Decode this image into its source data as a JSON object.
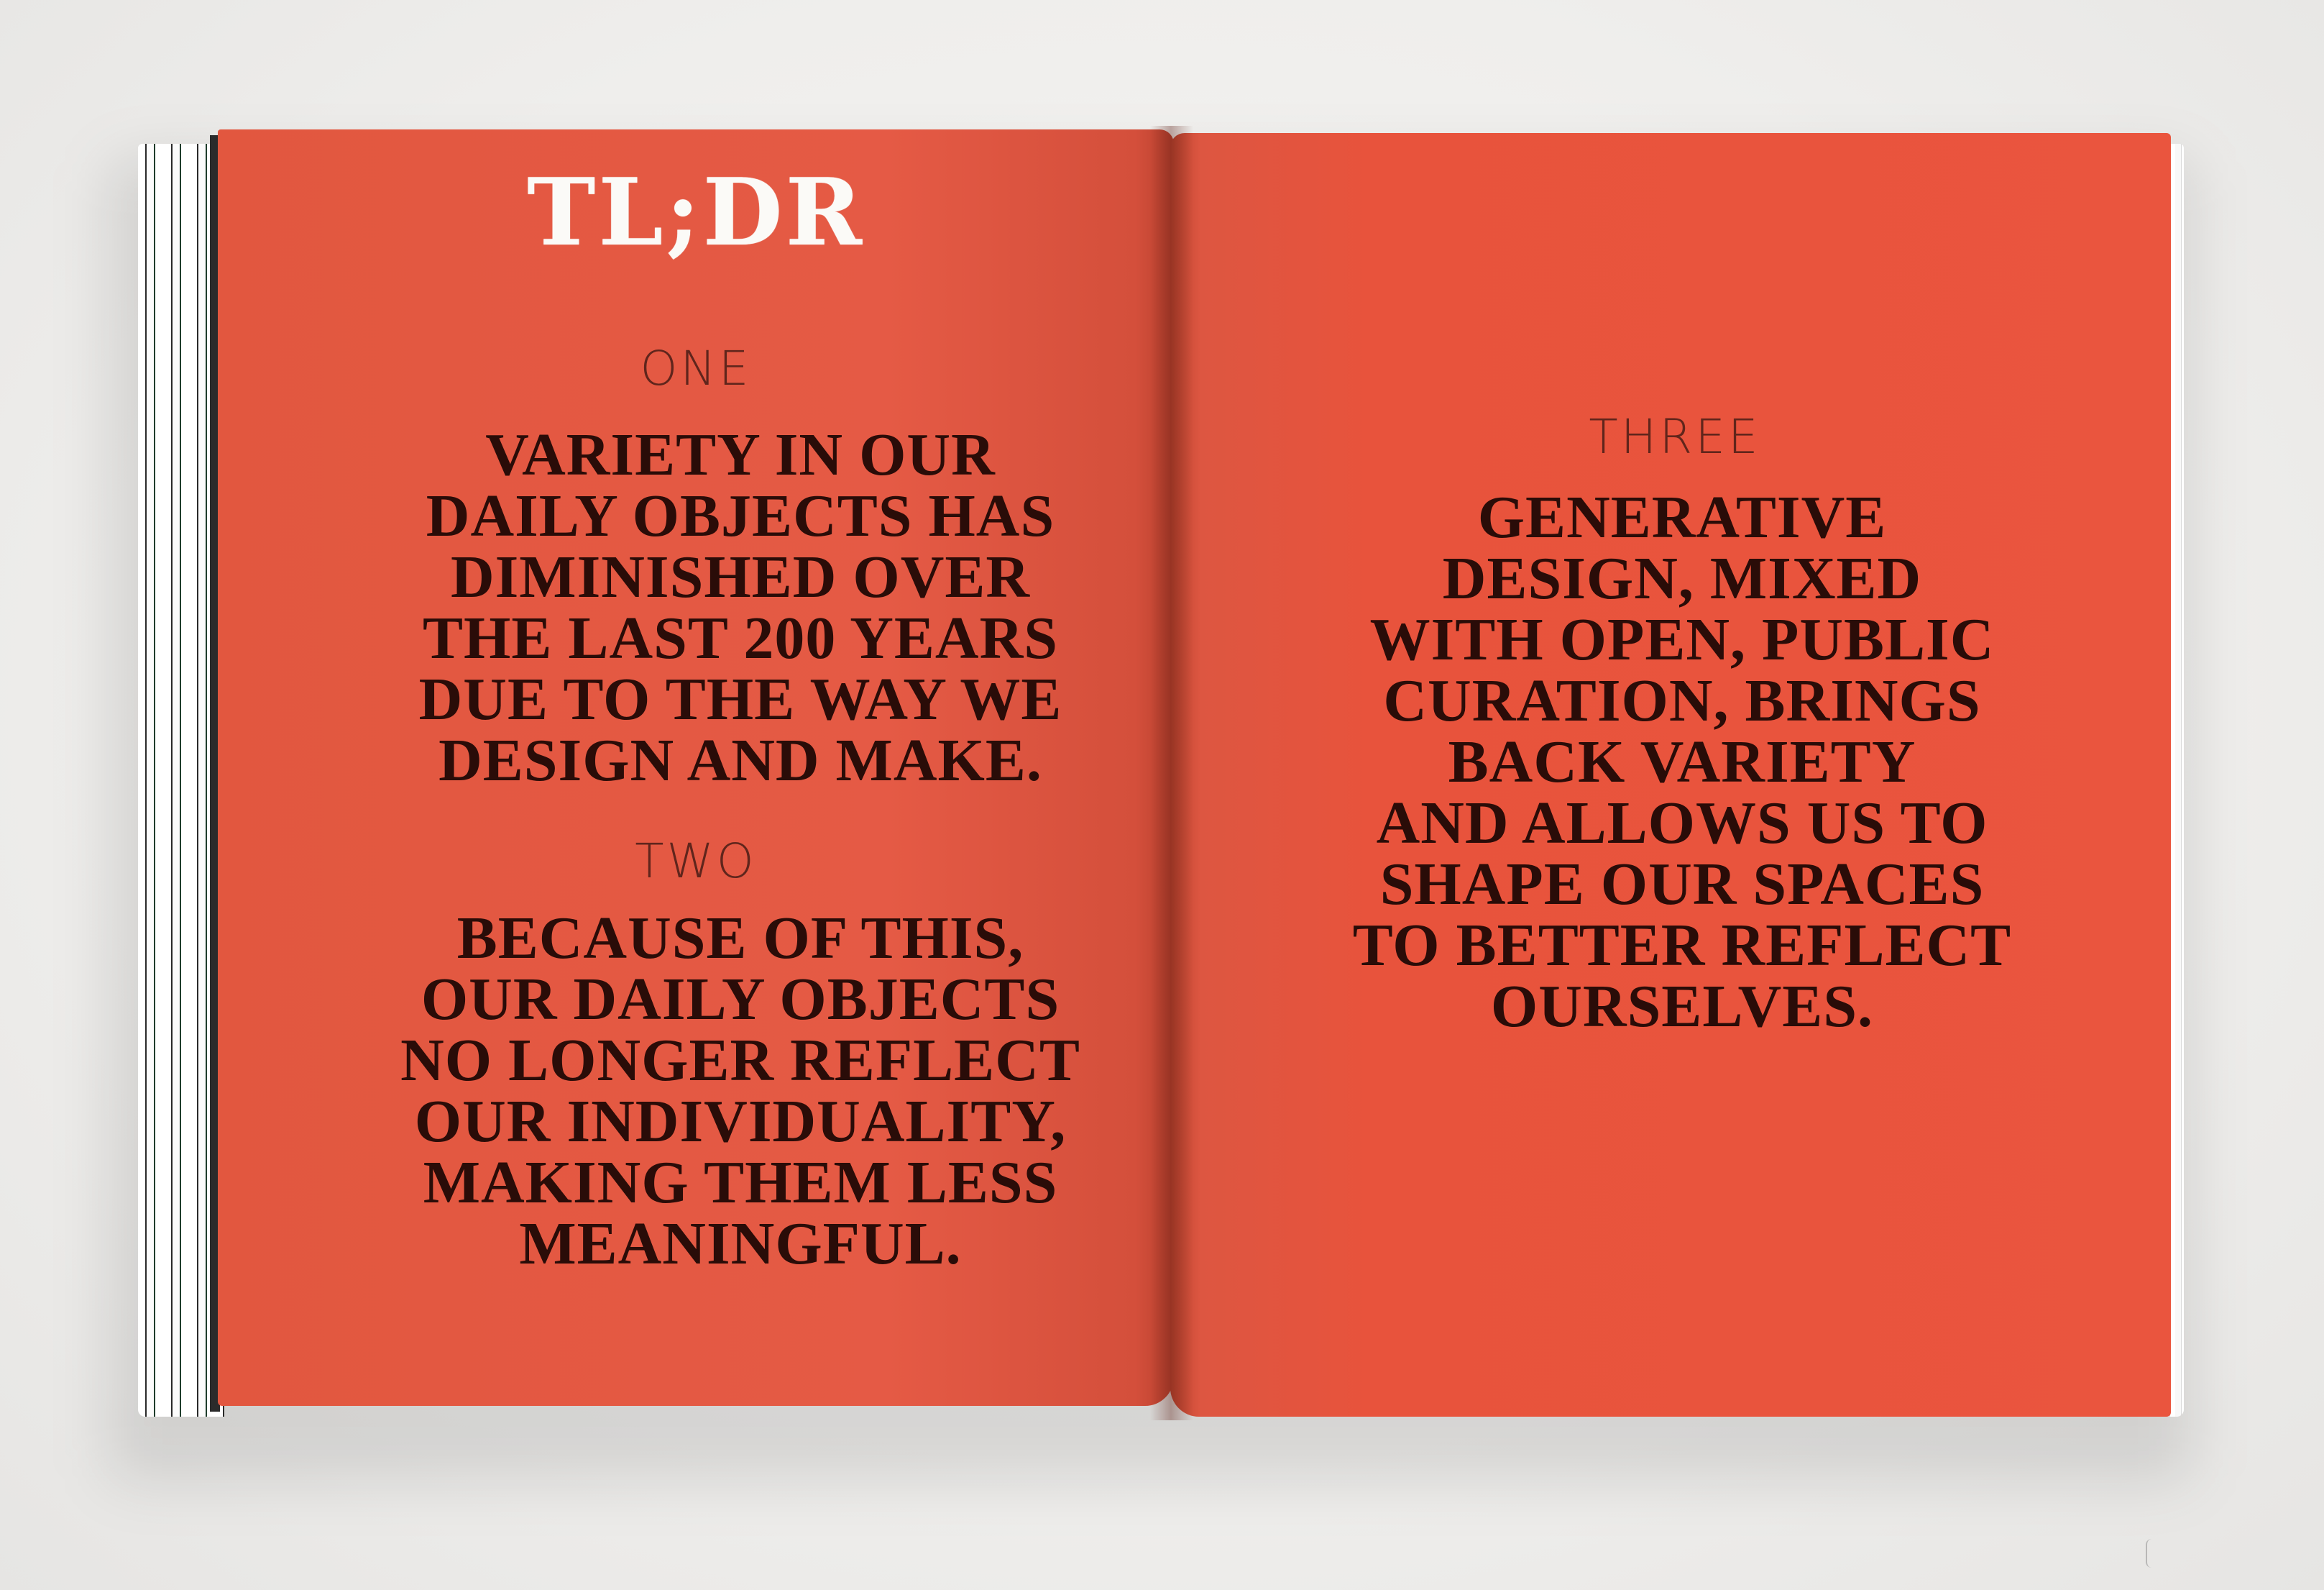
{
  "spread": {
    "left_page": {
      "title": "TL;DR",
      "sections": [
        {
          "label": "ONE",
          "lines": [
            "VARIETY IN OUR",
            "DAILY OBJECTS HAS",
            "DIMINISHED OVER",
            "THE LAST 200 YEARS",
            "DUE TO THE WAY WE",
            "DESIGN AND MAKE."
          ]
        },
        {
          "label": "TWO",
          "lines": [
            "BECAUSE OF THIS,",
            "OUR DAILY OBJECTS",
            "NO LONGER REFLECT",
            "OUR INDIVIDUALITY,",
            "MAKING THEM LESS",
            "MEANINGFUL."
          ]
        }
      ]
    },
    "right_page": {
      "sections": [
        {
          "label": "THREE",
          "lines": [
            "GENERATIVE",
            "DESIGN, MIXED",
            "WITH OPEN, PUBLIC",
            "CURATION, BRINGS",
            "BACK VARIETY",
            "AND  ALLOWS US TO",
            "SHAPE OUR SPACES",
            "TO BETTER REFLECT",
            "OURSELVES."
          ]
        }
      ]
    }
  },
  "colors": {
    "page": "#e55a45",
    "ink": "#2a0c08",
    "title": "#fbfaf7",
    "background": "#f1f0ee"
  }
}
